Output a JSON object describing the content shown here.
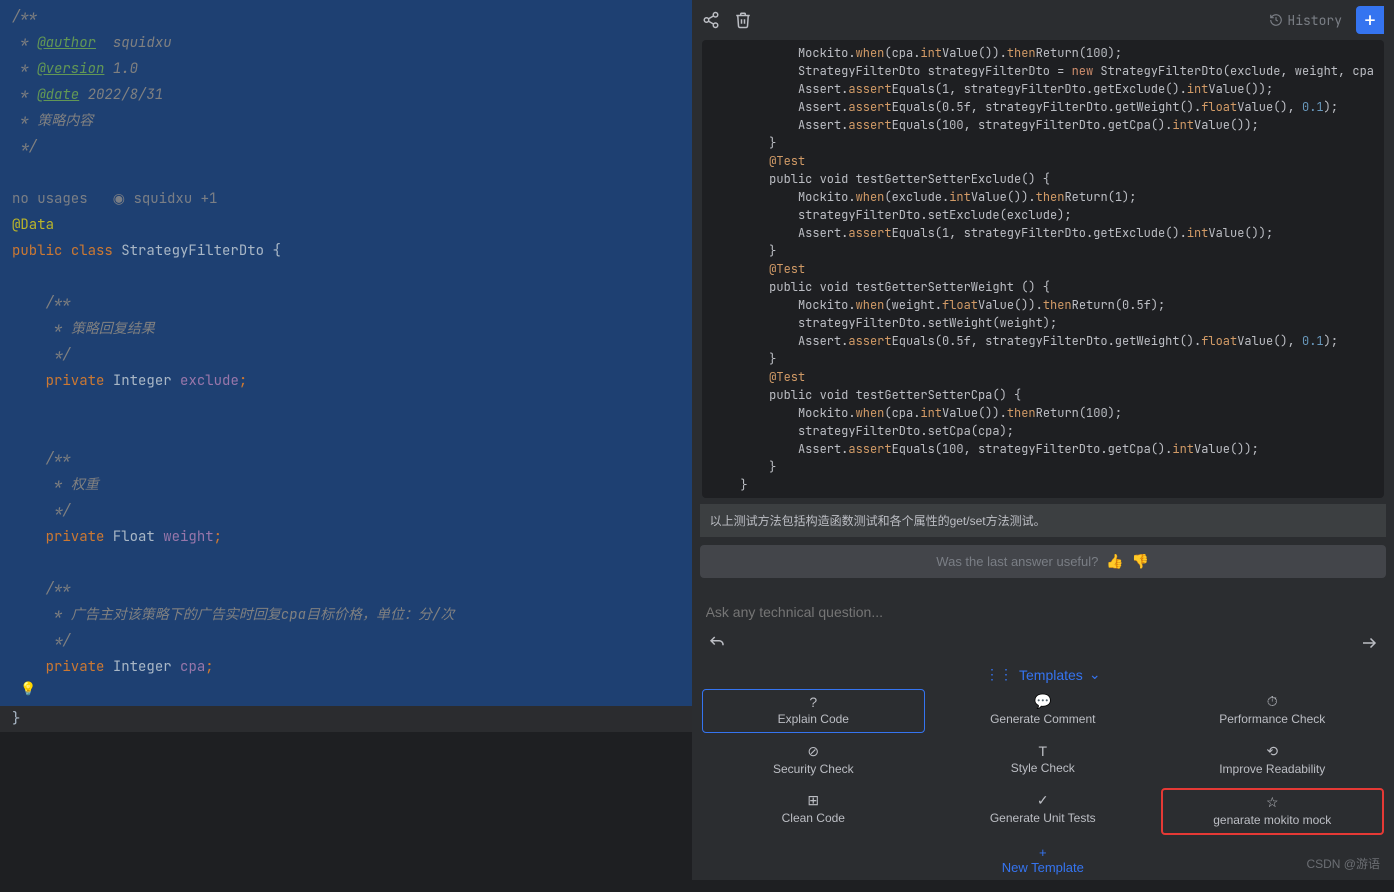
{
  "editor": {
    "author_tag": "@author",
    "author_val": "squidxu",
    "version_tag": "@version",
    "version_val": "1.0",
    "date_tag": "@date",
    "date_val": "2022/8/31",
    "desc_line": "策略内容",
    "usages": "no usages",
    "blame": "squidxu +1",
    "anno": "@Data",
    "kw_public": "public",
    "kw_class": "class",
    "class_name": "StrategyFilterDto",
    "brace_open": "{",
    "brace_close": "}",
    "kw_private": "private",
    "type_integer": "Integer",
    "type_float": "Float",
    "f_exclude": "exclude",
    "f_weight": "weight",
    "f_cpa": "cpa",
    "doc_exclude": "策略回复结果",
    "doc_weight": "权重",
    "doc_cpa": "广告主对该策略下的广告实时回复cpa目标价格，单位：分/次"
  },
  "right": {
    "history": "History",
    "code": {
      "l1a": "Mockito.",
      "l1b": "when",
      "l1c": "(cpa.",
      "l1d": "int",
      "l1e": "Value()).",
      "l1f": "then",
      "l1g": "Return(100);",
      "l2a": "StrategyFilterDto strategyFilterDto = ",
      "l2b": "new",
      "l2c": " StrategyFilterDto(exclude, weight, cpa",
      "l3a": "Assert.",
      "l3b": "assert",
      "l3c": "Equals(1, strategyFilterDto.getExclude().",
      "l3d": "int",
      "l3e": "Value());",
      "l4a": "Assert.",
      "l4b": "assert",
      "l4c": "Equals(0.5f, strategyFilterDto.getWeight().",
      "l4d": "float",
      "l4e": "Value(), ",
      "l4f": "0.1",
      "l4g": ");",
      "l5a": "Assert.",
      "l5b": "assert",
      "l5c": "Equals(100, strategyFilterDto.getCpa().",
      "l5d": "int",
      "l5e": "Value());",
      "rb": "}",
      "anno_test": "@Test",
      "m2": "public void testGetterSetterExclude() {",
      "m2l1a": "Mockito.",
      "m2l1b": "when",
      "m2l1c": "(exclude.",
      "m2l1d": "int",
      "m2l1e": "Value()).",
      "m2l1f": "then",
      "m2l1g": "Return(1);",
      "m2l2": "strategyFilterDto.setExclude(exclude);",
      "m2l3a": "Assert.",
      "m2l3b": "assert",
      "m2l3c": "Equals(1, strategyFilterDto.getExclude().",
      "m2l3d": "int",
      "m2l3e": "Value());",
      "m3": "public void testGetterSetterWeight () {",
      "m3l1a": "Mockito.",
      "m3l1b": "when",
      "m3l1c": "(weight.",
      "m3l1d": "float",
      "m3l1e": "Value()).",
      "m3l1f": "then",
      "m3l1g": "Return(0.5f);",
      "m3l2": "strategyFilterDto.setWeight(weight);",
      "m3l3a": "Assert.",
      "m3l3b": "assert",
      "m3l3c": "Equals(0.5f, strategyFilterDto.getWeight().",
      "m3l3d": "float",
      "m3l3e": "Value(), ",
      "m3l3f": "0.1",
      "m3l3g": ");",
      "m4": "public void testGetterSetterCpa() {",
      "m4l1a": "Mockito.",
      "m4l1b": "when",
      "m4l1c": "(cpa.",
      "m4l1d": "int",
      "m4l1e": "Value()).",
      "m4l1f": "then",
      "m4l1g": "Return(100);",
      "m4l2": "strategyFilterDto.setCpa(cpa);",
      "m4l3a": "Assert.",
      "m4l3b": "assert",
      "m4l3c": "Equals(100, strategyFilterDto.getCpa().",
      "m4l3d": "int",
      "m4l3e": "Value());"
    },
    "answer_desc": "以上测试方法包括构造函数测试和各个属性的get/set方法测试。",
    "useful": "Was the last answer useful?",
    "placeholder": "Ask any technical question...",
    "templates_header": "Templates",
    "templates": [
      {
        "label": "Explain Code",
        "active": true
      },
      {
        "label": "Generate Comment"
      },
      {
        "label": "Performance Check"
      },
      {
        "label": "Security Check"
      },
      {
        "label": "Style Check"
      },
      {
        "label": "Improve Readability"
      },
      {
        "label": "Clean Code"
      },
      {
        "label": "Generate Unit Tests"
      },
      {
        "label": "genarate mokito mock",
        "highlight": true
      }
    ],
    "new_template": "New Template"
  },
  "watermark": "CSDN @游语"
}
